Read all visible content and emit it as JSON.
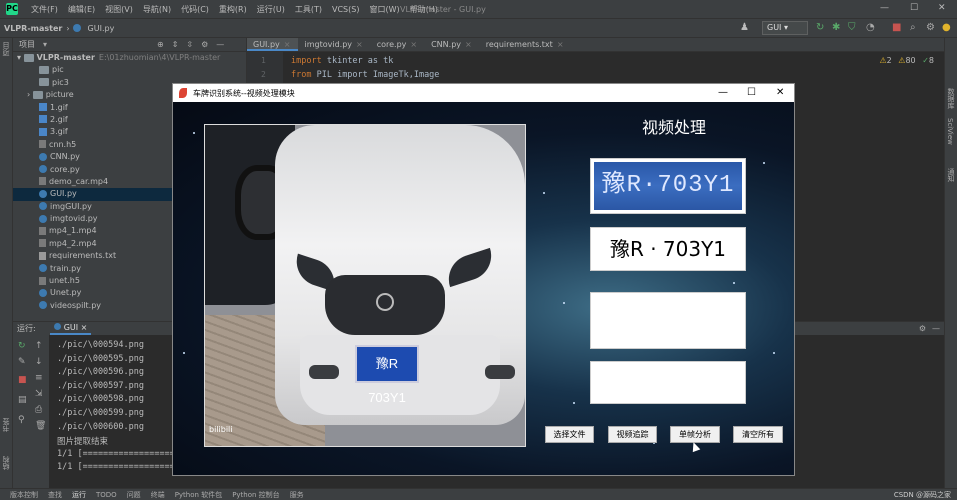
{
  "menubar": {
    "items": [
      "文件(F)",
      "编辑(E)",
      "视图(V)",
      "导航(N)",
      "代码(C)",
      "重构(R)",
      "运行(U)",
      "工具(T)",
      "VCS(S)",
      "窗口(W)",
      "帮助(H)"
    ],
    "window_title": "VLPR-master - GUI.py"
  },
  "navbar": {
    "project": "VLPR-master",
    "file": "GUI.py",
    "run_config": "GUI"
  },
  "project_panel": {
    "title": "项目",
    "root": "VLPR-master",
    "root_path": "E:\\01zhuomian\\4\\VLPR-master",
    "items": [
      {
        "name": "pic",
        "type": "folder"
      },
      {
        "name": "pic3",
        "type": "folder"
      },
      {
        "name": "picture",
        "type": "folder"
      },
      {
        "name": "1.gif",
        "type": "gif"
      },
      {
        "name": "2.gif",
        "type": "gif"
      },
      {
        "name": "3.gif",
        "type": "gif"
      },
      {
        "name": "cnn.h5",
        "type": "h5"
      },
      {
        "name": "CNN.py",
        "type": "py"
      },
      {
        "name": "core.py",
        "type": "py"
      },
      {
        "name": "demo_car.mp4",
        "type": "h5"
      },
      {
        "name": "GUI.py",
        "type": "py"
      },
      {
        "name": "imgGUI.py",
        "type": "py"
      },
      {
        "name": "imgtovid.py",
        "type": "py"
      },
      {
        "name": "mp4_1.mp4",
        "type": "h5"
      },
      {
        "name": "mp4_2.mp4",
        "type": "h5"
      },
      {
        "name": "requirements.txt",
        "type": "txt"
      },
      {
        "name": "train.py",
        "type": "py"
      },
      {
        "name": "unet.h5",
        "type": "h5"
      },
      {
        "name": "Unet.py",
        "type": "py"
      },
      {
        "name": "videospilt.py",
        "type": "py"
      }
    ]
  },
  "editor": {
    "tabs": [
      "GUI.py",
      "imgtovid.py",
      "core.py",
      "CNN.py",
      "requirements.txt"
    ],
    "lines": [
      {
        "no": "1",
        "kw": "import",
        "rest": " tkinter as tk"
      },
      {
        "no": "2",
        "kw": "from",
        "rest": " PIL import ImageTk,Image"
      }
    ],
    "inspections": {
      "warnings": "2",
      "weak": "80",
      "ok": "8"
    }
  },
  "run_panel": {
    "label": "运行:",
    "tab": "GUI",
    "console": [
      "./pic/\\000594.png",
      "./pic/\\000595.png",
      "./pic/\\000596.png",
      "./pic/\\000597.png",
      "./pic/\\000598.png",
      "./pic/\\000599.png",
      "./pic/\\000600.png",
      "图片提取结束",
      "1/1 [==================",
      "1/1 [=================="
    ]
  },
  "statusbar": {
    "items": [
      "版本控制",
      "查找",
      "运行",
      "TODO",
      "问题",
      "终端",
      "Python 软件包",
      "Python 控制台",
      "服务"
    ],
    "watermark": "CSDN @源码之家"
  },
  "left_strip_tabs": [
    "项目",
    "书签",
    "结构"
  ],
  "right_strip_tabs": [
    "数据库",
    "SciView",
    "通知"
  ],
  "dialog": {
    "title": "车牌识别系统--视频处理模块",
    "heading": "视频处理",
    "plate_crop_text": "豫R·703Y1",
    "result_text": "豫R · 703Y1",
    "video_plate_text": "豫R 703Y1",
    "video_overlay": "bilibili",
    "buttons": [
      "选择文件",
      "视频追踪",
      "单帧分析",
      "清空所有"
    ]
  }
}
